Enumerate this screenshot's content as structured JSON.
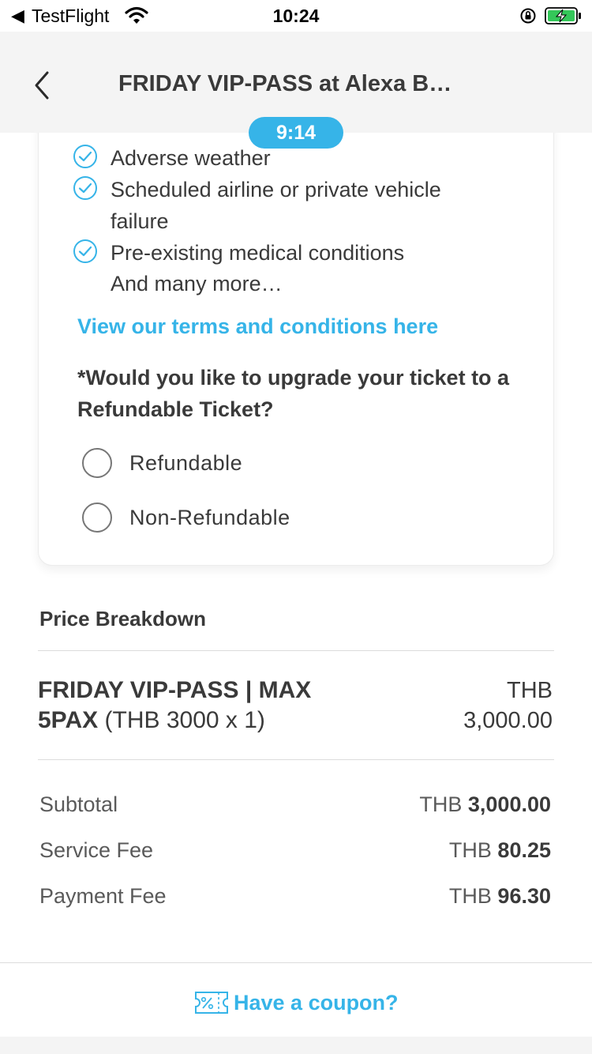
{
  "status_bar": {
    "back_label": "◀",
    "app_label": "TestFlight",
    "time": "10:24"
  },
  "header": {
    "title": "FRIDAY VIP-PASS at Alexa B…",
    "timer": "9:14"
  },
  "coverage": {
    "items": [
      "Adverse weather",
      "Scheduled airline or private vehicle failure",
      "Pre-existing medical conditions"
    ],
    "more": "And many more…",
    "terms_link": "View our terms and conditions here"
  },
  "upgrade": {
    "question": "*Would you like to upgrade your ticket to a Refundable Ticket?",
    "options": [
      "Refundable",
      "Non-Refundable"
    ]
  },
  "price_breakdown": {
    "title": "Price Breakdown",
    "item": {
      "name": "FRIDAY VIP-PASS | MAX 5PAX",
      "qty_text": "(THB 3000 x 1)",
      "currency": "THB",
      "amount": "3,000.00"
    },
    "fees": [
      {
        "label": "Subtotal",
        "currency": "THB",
        "amount": "3,000.00"
      },
      {
        "label": "Service Fee",
        "currency": "THB",
        "amount": "80.25"
      },
      {
        "label": "Payment Fee",
        "currency": "THB",
        "amount": "96.30"
      }
    ]
  },
  "coupon": {
    "label": "Have a coupon?"
  },
  "colors": {
    "accent": "#36b4e8",
    "text": "#3a3a3a",
    "header_bg": "#f4f4f4",
    "battery_green": "#34c759"
  }
}
